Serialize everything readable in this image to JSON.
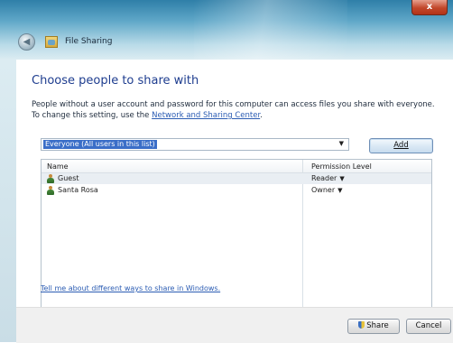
{
  "window": {
    "title": "File Sharing",
    "close_label": "x"
  },
  "dialog": {
    "heading": "Choose people to share with",
    "description_line1": "People without a user account and password for this computer can access files you share with everyone.",
    "description_line2_prefix": "To change this setting, use the ",
    "description_link": "Network and Sharing Center",
    "description_line2_suffix": "."
  },
  "picker": {
    "selected_value": "Everyone (All users in this list)",
    "add_label": "Add"
  },
  "grid": {
    "columns": [
      "Name",
      "Permission Level"
    ],
    "rows": [
      {
        "name": "Guest",
        "permission": "Reader",
        "selected": true
      },
      {
        "name": "Santa Rosa",
        "permission": "Owner",
        "selected": false
      }
    ]
  },
  "help_link": "Tell me about different ways to share in Windows.",
  "footer": {
    "share_label": "Share",
    "cancel_label": "Cancel"
  },
  "colors": {
    "heading": "#1e3d8f",
    "link": "#2b5cb3",
    "selection": "#3a6ec8"
  },
  "icons": {
    "back": "back-arrow-icon",
    "app": "file-sharing-icon",
    "user": "user-icon",
    "shield": "shield-icon",
    "dropdown": "chevron-down-icon"
  }
}
